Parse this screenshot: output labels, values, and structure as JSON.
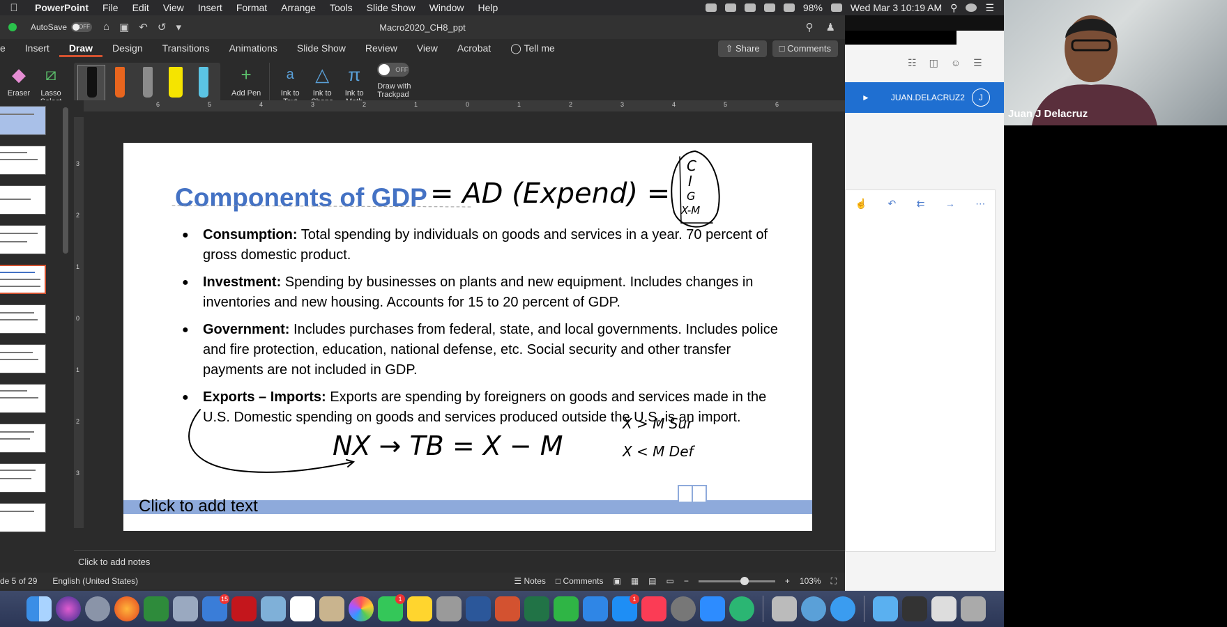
{
  "menubar": {
    "app": "PowerPoint",
    "items": [
      "File",
      "Edit",
      "View",
      "Insert",
      "Format",
      "Arrange",
      "Tools",
      "Slide Show",
      "Window",
      "Help"
    ],
    "battery": "98%",
    "datetime": "Wed Mar 3  10:19 AM"
  },
  "titlebar": {
    "autosave_label": "AutoSave",
    "autosave_state": "OFF",
    "doc_title": "Macro2020_CH8_ppt"
  },
  "tabs": {
    "items": [
      "e",
      "Insert",
      "Draw",
      "Design",
      "Transitions",
      "Animations",
      "Slide Show",
      "Review",
      "View",
      "Acrobat",
      "Tell me"
    ],
    "active": "Draw",
    "share": "Share",
    "comments": "Comments"
  },
  "ribbon": {
    "eraser": "Eraser",
    "lasso": "Lasso\nSelect",
    "add_pen": "Add Pen",
    "ink_to_text": "Ink to\nText",
    "ink_to_shape": "Ink to\nShape",
    "ink_to_math": "Ink to\nMath",
    "trackpad_toggle": "OFF",
    "trackpad_label": "Draw with\nTrackpad",
    "pen_colors": [
      "#111111",
      "#e8651e",
      "#8b8b8b",
      "#f5e400",
      "#5bc4e4"
    ]
  },
  "ruler": {
    "top_labels": [
      "6",
      "5",
      "4",
      "3",
      "2",
      "1",
      "0",
      "1",
      "2",
      "3",
      "4",
      "5",
      "6"
    ],
    "left_labels": [
      "3",
      "2",
      "1",
      "0",
      "1",
      "2",
      "3"
    ]
  },
  "slide": {
    "title": "Components of GDP",
    "bullets": [
      {
        "term": "Consumption:",
        "text": " Total spending by individuals on goods and services in a year. 70 percent of gross domestic product."
      },
      {
        "term": "Investment:",
        "text": "  Spending by businesses on plants and new equipment.  Includes changes in inventories and new housing. Accounts for 15 to 20 percent of GDP."
      },
      {
        "term": "Government:",
        "text": "  Includes purchases from federal, state, and local governments. Includes police and fire protection, education, national defense, etc. Social security and other transfer payments are not included in GDP."
      },
      {
        "term": "Exports – Imports:",
        "text": "  Exports are spending by foreigners on goods and services made in the U.S. Domestic spending on goods and services produced outside the U.S. is an import."
      }
    ],
    "footer_placeholder": "Click to add text",
    "ink": {
      "equals_ad": "=  AD (Expend) =",
      "components": [
        "C",
        "I",
        "G",
        "X-M"
      ],
      "nx_line": "NX → TB = X − M",
      "surplus_line": "X > M  Sur",
      "deficit_line": "X < M  Def"
    }
  },
  "notes": {
    "placeholder": "Click to add notes"
  },
  "statusbar": {
    "slide_count": "de 5 of 29",
    "language": "English (United States)",
    "notes": "Notes",
    "comments": "Comments",
    "zoom": "103%"
  },
  "browser": {
    "user": "JUAN.DELACRUZ2",
    "avatar_initial": "J"
  },
  "webcam": {
    "name": "Juan J Delacruz"
  },
  "colors": {
    "accent": "#d35230",
    "title_blue": "#4472c4",
    "footer_band": "#8eaadb",
    "browser_blue": "#1f6fd1"
  }
}
